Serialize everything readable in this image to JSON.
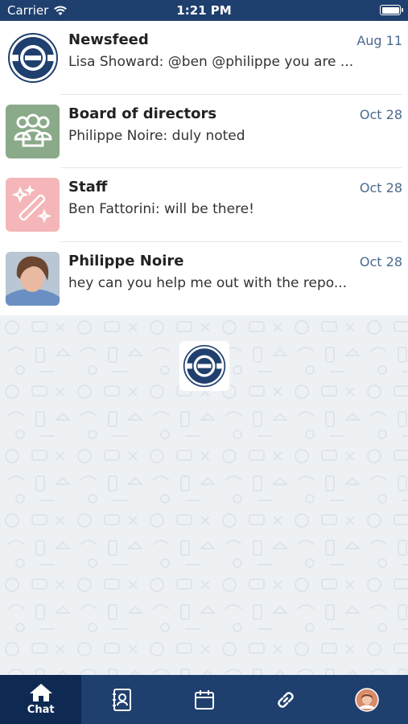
{
  "status": {
    "carrier": "Carrier",
    "time": "1:21 PM"
  },
  "chats": [
    {
      "title": "Newsfeed",
      "date": "Aug 11",
      "preview": "Lisa Showard: @ben @philippe you are ...",
      "avatar": "union-logo-icon"
    },
    {
      "title": "Board of directors",
      "date": "Oct 28",
      "preview": "Philippe Noire: duly noted",
      "avatar": "group-icon",
      "avatar_color": "#8aaa8a"
    },
    {
      "title": "Staff",
      "date": "Oct 28",
      "preview": "Ben Fattorini: will be there!",
      "avatar": "magic-wand-icon",
      "avatar_color": "#f4b6b8"
    },
    {
      "title": "Philippe Noire",
      "date": "Oct 28",
      "preview": "hey can you help me out with the repo...",
      "avatar": "person-photo"
    }
  ],
  "tabs": [
    {
      "label": "Chat",
      "icon": "home-icon",
      "active": true
    },
    {
      "label": "",
      "icon": "contacts-icon"
    },
    {
      "label": "",
      "icon": "calendar-icon"
    },
    {
      "label": "",
      "icon": "link-icon"
    },
    {
      "label": "",
      "icon": "profile-avatar"
    }
  ],
  "colors": {
    "nav": "#1f3f6e",
    "nav_active": "#0e2a52",
    "date": "#4a6a8f"
  }
}
